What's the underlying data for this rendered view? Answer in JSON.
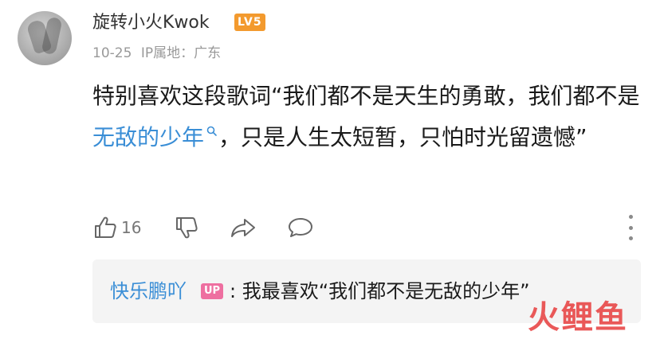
{
  "comment": {
    "username": "旋转小火Kwok",
    "level_badge": "LV5",
    "date": "10-25",
    "ip_location": "IP属地：广东",
    "text_before": "特别喜欢这段歌词“我们都不是天生的勇敢，我们都不是",
    "link_text": "无敌的少年",
    "text_after": "，只是人生太短暂，只怕时光留遗憾”",
    "like_count": "16"
  },
  "reply": {
    "name": "快乐鹏吖",
    "badge": "UP",
    "text": ": 我最喜欢“我们都不是无敌的少年”"
  },
  "watermark": "火鲤鱼",
  "colors": {
    "link": "#3a8ed6",
    "level_badge": "#f39a2e",
    "up_badge": "#ee6fa0",
    "meta_text": "#999999",
    "reply_bg": "#f4f4f4"
  },
  "icons": [
    "thumbs-up-icon",
    "thumbs-down-icon",
    "share-icon",
    "comment-bubble-icon",
    "more-vertical-icon",
    "search-icon"
  ]
}
